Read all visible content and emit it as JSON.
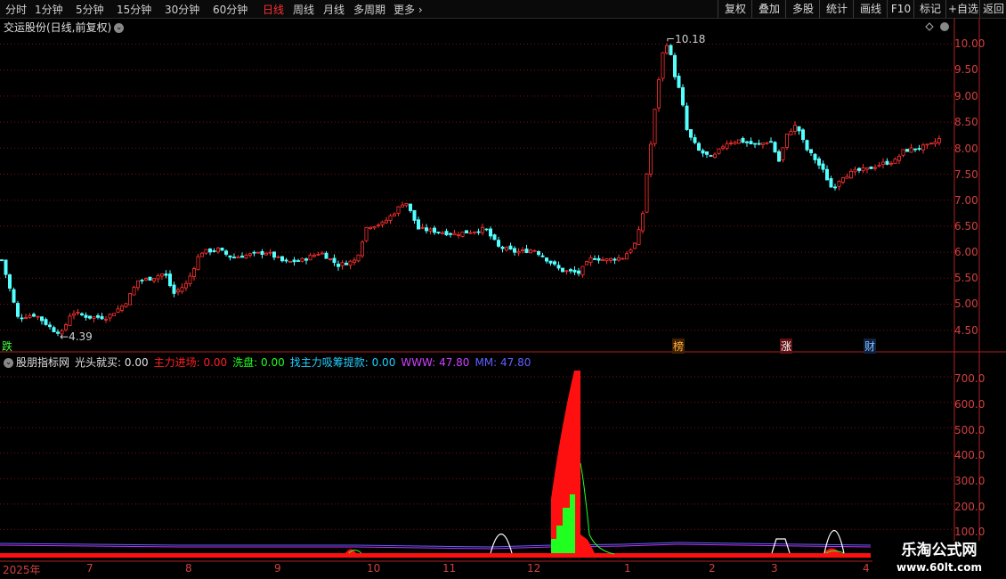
{
  "toolbar": {
    "timeframes": [
      "分时",
      "1分钟",
      "5分钟",
      "15分钟",
      "30分钟",
      "60分钟",
      "日线",
      "周线",
      "月线",
      "多周期",
      "更多"
    ],
    "active": "日线",
    "buttons": [
      "复权",
      "叠加",
      "多股",
      "统计",
      "画线",
      "F10",
      "标记",
      "+自选",
      "返回"
    ]
  },
  "stock": {
    "title": "交运股份(日线,前复权)"
  },
  "price_axis": [
    "10.00",
    "9.50",
    "9.00",
    "8.50",
    "8.00",
    "7.50",
    "7.00",
    "6.50",
    "6.00",
    "5.50",
    "5.00",
    "4.50"
  ],
  "markers": {
    "high": "10.18",
    "low": "4.39"
  },
  "flags": [
    "跌",
    "榜",
    "涨",
    "财"
  ],
  "indicator": {
    "name": "股朋指标网",
    "lines": [
      {
        "label": "光头就买: 0.00",
        "color": "#e0e0e0"
      },
      {
        "label": "主力进场: 0.00",
        "color": "#ff2020"
      },
      {
        "label": "洗盘: 0.00",
        "color": "#20ff20"
      },
      {
        "label": "找主力吸筹提款: 0.00",
        "color": "#20d0ff"
      },
      {
        "label": "WWW: 47.80",
        "color": "#d040ff"
      },
      {
        "label": "MM: 47.80",
        "color": "#6060ff"
      }
    ]
  },
  "indicator_axis": [
    "700.0",
    "600.0",
    "500.0",
    "400.0",
    "300.0",
    "200.0",
    "100.0"
  ],
  "x_axis": [
    "2025年",
    "7",
    "8",
    "9",
    "10",
    "11",
    "12",
    "1",
    "2",
    "3",
    "4"
  ],
  "watermark": {
    "line1": "乐淘公式网",
    "line2": "www.60lt.com"
  },
  "colors": {
    "up": "#ff3030",
    "down": "#54ffff",
    "axis": "#b02020",
    "grid": "#7a1010"
  }
}
